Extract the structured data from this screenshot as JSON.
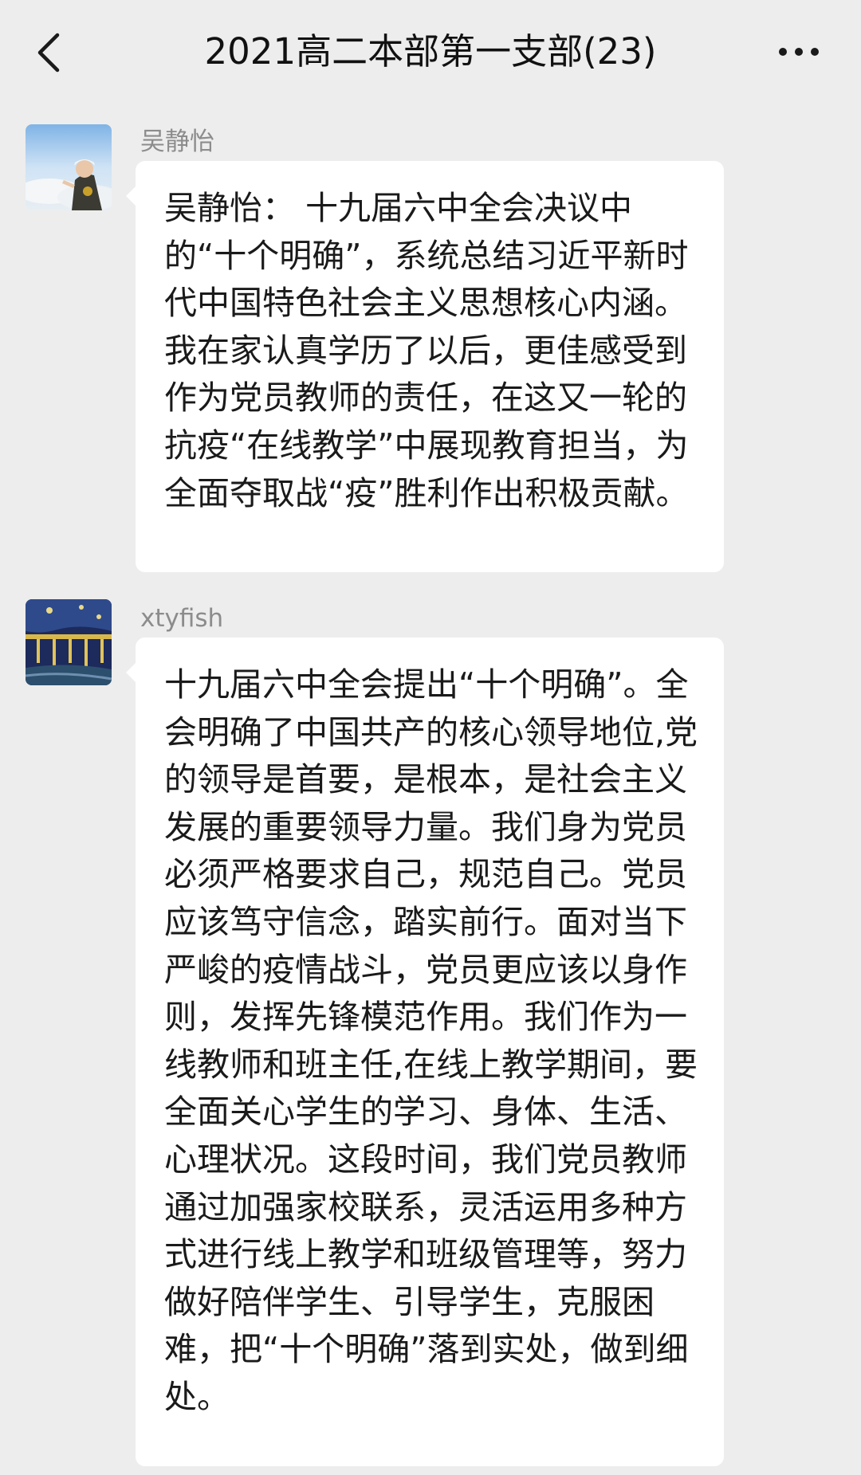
{
  "header": {
    "title": "2021高二本部第一支部(23)",
    "back_icon": "chevron-left-icon",
    "more_icon": "ellipsis-icon"
  },
  "messages": [
    {
      "sender": "吴静怡",
      "text": "吴静怡： 十九届六中全会决议中的“十个明确”，系统总结习近平新时代中国特色社会主义思想核心内涵。我在家认真学历了以后，更佳感受到作为党员教师的责任，在这又一轮的抗疫“在线教学”中展现教育担当，为全面夺取战“疫”胜利作出积极贡献。"
    },
    {
      "sender": "xtyfish",
      "text": "十九届六中全会提出“十个明确”。全会明确了中国共产的核心领导地位,党的领导是首要，是根本，是社会主义发展的重要领导力量。我们身为党员必须严格要求自己，规范自己。党员应该笃守信念，踏实前行。面对当下严峻的疫情战斗，党员更应该以身作则，发挥先锋模范作用。我们作为一线教师和班主任,在线上教学期间，要全面关心学生的学习、身体、生活、心理状况。这段时间，我们党员教师通过加强家校联系，灵活运用多种方式进行线上教学和班级管理等，努力做好陪伴学生、引导学生，克服困难，把“十个明确”落到实处，做到细处。"
    }
  ],
  "colors": {
    "background": "#ededed",
    "bubble": "#ffffff",
    "sender_name": "#8c8c8c",
    "text": "#1a1a1a"
  }
}
